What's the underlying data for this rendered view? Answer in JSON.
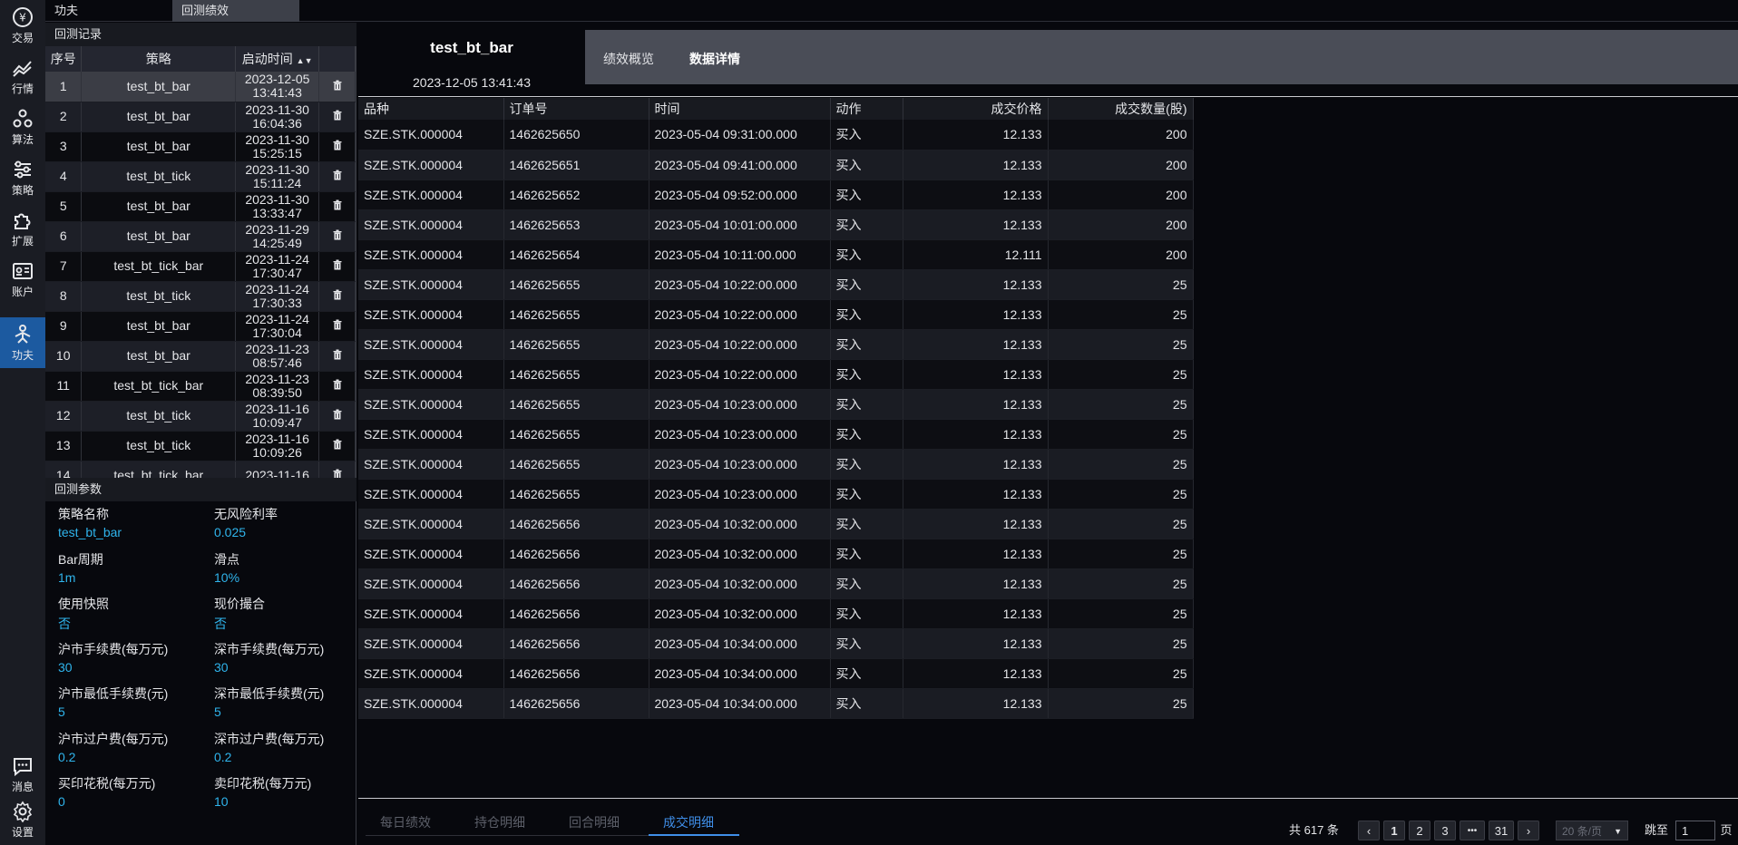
{
  "nav": [
    {
      "label": "交易",
      "icon": "yen-circle-icon"
    },
    {
      "label": "行情",
      "icon": "market-chart-icon"
    },
    {
      "label": "算法",
      "icon": "algorithm-icon"
    },
    {
      "label": "策略",
      "icon": "strategy-sliders-icon"
    },
    {
      "label": "扩展",
      "icon": "puzzle-icon"
    },
    {
      "label": "账户",
      "icon": "id-card-icon"
    },
    {
      "label": "功夫",
      "icon": "kungfu-icon",
      "active": true
    },
    {
      "label": "消息",
      "icon": "message-icon"
    },
    {
      "label": "设置",
      "icon": "gear-icon"
    }
  ],
  "top_tabs": [
    "功夫",
    "回测绩效"
  ],
  "records": {
    "title": "回测记录",
    "headers": [
      "序号",
      "策略",
      "启动时间"
    ],
    "rows": [
      {
        "no": "1",
        "strategy": "test_bt_bar",
        "date": "2023-12-05",
        "time": "13:41:43"
      },
      {
        "no": "2",
        "strategy": "test_bt_bar",
        "date": "2023-11-30",
        "time": "16:04:36"
      },
      {
        "no": "3",
        "strategy": "test_bt_bar",
        "date": "2023-11-30",
        "time": "15:25:15"
      },
      {
        "no": "4",
        "strategy": "test_bt_tick",
        "date": "2023-11-30",
        "time": "15:11:24"
      },
      {
        "no": "5",
        "strategy": "test_bt_bar",
        "date": "2023-11-30",
        "time": "13:33:47"
      },
      {
        "no": "6",
        "strategy": "test_bt_bar",
        "date": "2023-11-29",
        "time": "14:25:49"
      },
      {
        "no": "7",
        "strategy": "test_bt_tick_bar",
        "date": "2023-11-24",
        "time": "17:30:47"
      },
      {
        "no": "8",
        "strategy": "test_bt_tick",
        "date": "2023-11-24",
        "time": "17:30:33"
      },
      {
        "no": "9",
        "strategy": "test_bt_bar",
        "date": "2023-11-24",
        "time": "17:30:04"
      },
      {
        "no": "10",
        "strategy": "test_bt_bar",
        "date": "2023-11-23",
        "time": "08:57:46"
      },
      {
        "no": "11",
        "strategy": "test_bt_tick_bar",
        "date": "2023-11-23",
        "time": "08:39:50"
      },
      {
        "no": "12",
        "strategy": "test_bt_tick",
        "date": "2023-11-16",
        "time": "10:09:47"
      },
      {
        "no": "13",
        "strategy": "test_bt_tick",
        "date": "2023-11-16",
        "time": "10:09:26"
      },
      {
        "no": "14",
        "strategy": "test_bt_tick_bar",
        "date": "2023-11-16",
        "time": ""
      }
    ]
  },
  "params": {
    "title": "回测参数",
    "items": [
      {
        "label": "策略名称",
        "value": "test_bt_bar"
      },
      {
        "label": "无风险利率",
        "value": "0.025"
      },
      {
        "label": "Bar周期",
        "value": "1m"
      },
      {
        "label": "滑点",
        "value": "10%"
      },
      {
        "label": "使用快照",
        "value": "否"
      },
      {
        "label": "现价撮合",
        "value": "否"
      },
      {
        "label": "沪市手续费(每万元)",
        "value": "30"
      },
      {
        "label": "深市手续费(每万元)",
        "value": "30"
      },
      {
        "label": "沪市最低手续费(元)",
        "value": "5"
      },
      {
        "label": "深市最低手续费(元)",
        "value": "5"
      },
      {
        "label": "沪市过户费(每万元)",
        "value": "0.2"
      },
      {
        "label": "深市过户费(每万元)",
        "value": "0.2"
      },
      {
        "label": "买印花税(每万元)",
        "value": "0"
      },
      {
        "label": "卖印花税(每万元)",
        "value": "10"
      }
    ]
  },
  "header": {
    "strategy_name": "test_bt_bar",
    "start_time": "2023-12-05 13:41:43",
    "tabs": [
      "绩效概览",
      "数据详情"
    ]
  },
  "trades": {
    "headers": [
      "品种",
      "订单号",
      "时间",
      "动作",
      "成交价格",
      "成交数量(股)"
    ],
    "rows": [
      [
        "SZE.STK.000004",
        "1462625650",
        "2023-05-04 09:31:00.000",
        "买入",
        "12.133",
        "200"
      ],
      [
        "SZE.STK.000004",
        "1462625651",
        "2023-05-04 09:41:00.000",
        "买入",
        "12.133",
        "200"
      ],
      [
        "SZE.STK.000004",
        "1462625652",
        "2023-05-04 09:52:00.000",
        "买入",
        "12.133",
        "200"
      ],
      [
        "SZE.STK.000004",
        "1462625653",
        "2023-05-04 10:01:00.000",
        "买入",
        "12.133",
        "200"
      ],
      [
        "SZE.STK.000004",
        "1462625654",
        "2023-05-04 10:11:00.000",
        "买入",
        "12.111",
        "200"
      ],
      [
        "SZE.STK.000004",
        "1462625655",
        "2023-05-04 10:22:00.000",
        "买入",
        "12.133",
        "25"
      ],
      [
        "SZE.STK.000004",
        "1462625655",
        "2023-05-04 10:22:00.000",
        "买入",
        "12.133",
        "25"
      ],
      [
        "SZE.STK.000004",
        "1462625655",
        "2023-05-04 10:22:00.000",
        "买入",
        "12.133",
        "25"
      ],
      [
        "SZE.STK.000004",
        "1462625655",
        "2023-05-04 10:22:00.000",
        "买入",
        "12.133",
        "25"
      ],
      [
        "SZE.STK.000004",
        "1462625655",
        "2023-05-04 10:23:00.000",
        "买入",
        "12.133",
        "25"
      ],
      [
        "SZE.STK.000004",
        "1462625655",
        "2023-05-04 10:23:00.000",
        "买入",
        "12.133",
        "25"
      ],
      [
        "SZE.STK.000004",
        "1462625655",
        "2023-05-04 10:23:00.000",
        "买入",
        "12.133",
        "25"
      ],
      [
        "SZE.STK.000004",
        "1462625655",
        "2023-05-04 10:23:00.000",
        "买入",
        "12.133",
        "25"
      ],
      [
        "SZE.STK.000004",
        "1462625656",
        "2023-05-04 10:32:00.000",
        "买入",
        "12.133",
        "25"
      ],
      [
        "SZE.STK.000004",
        "1462625656",
        "2023-05-04 10:32:00.000",
        "买入",
        "12.133",
        "25"
      ],
      [
        "SZE.STK.000004",
        "1462625656",
        "2023-05-04 10:32:00.000",
        "买入",
        "12.133",
        "25"
      ],
      [
        "SZE.STK.000004",
        "1462625656",
        "2023-05-04 10:32:00.000",
        "买入",
        "12.133",
        "25"
      ],
      [
        "SZE.STK.000004",
        "1462625656",
        "2023-05-04 10:34:00.000",
        "买入",
        "12.133",
        "25"
      ],
      [
        "SZE.STK.000004",
        "1462625656",
        "2023-05-04 10:34:00.000",
        "买入",
        "12.133",
        "25"
      ],
      [
        "SZE.STK.000004",
        "1462625656",
        "2023-05-04 10:34:00.000",
        "买入",
        "12.133",
        "25"
      ]
    ]
  },
  "bottom_tabs": [
    "每日绩效",
    "持仓明细",
    "回合明细",
    "成交明细"
  ],
  "pager": {
    "total": "共 617 条",
    "pages": [
      "1",
      "2",
      "3",
      "•••",
      "31"
    ],
    "page_size": "20 条/页",
    "goto_label": "跳至",
    "goto_value": "1",
    "page_suffix": "页"
  },
  "colors": {
    "accent": "#1c5aa0",
    "value": "#2fb4ec",
    "link": "#3f8ee8"
  }
}
